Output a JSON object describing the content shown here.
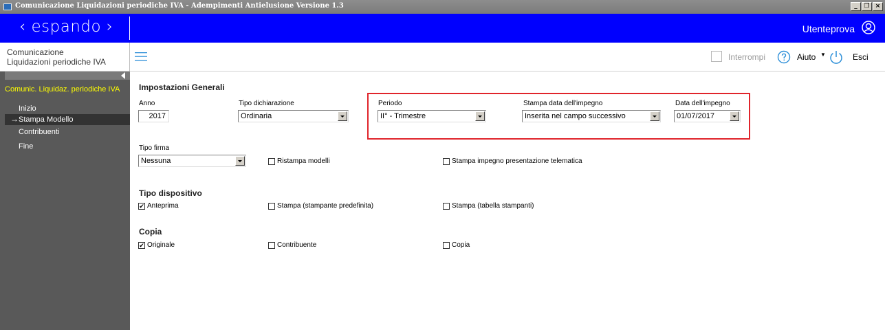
{
  "window": {
    "title": "Comunicazione Liquidazioni periodiche IVA - Adempimenti Antielusione Versione 1.3",
    "controls": [
      "_",
      "❐",
      "×"
    ]
  },
  "brand": {
    "logo": "‹ espando ›",
    "user_name": "Utenteprova",
    "color": "#0000fe"
  },
  "toolbar": {
    "module_title_line1": "Comunicazione",
    "module_title_line2": "Liquidazioni periodiche IVA",
    "interrompi_label": "Interrompi",
    "aiuto_label": "Aiuto",
    "esci_label": "Esci"
  },
  "sidebar": {
    "header": "Comunic. Liquidaz. periodiche IVA",
    "items": [
      {
        "label": "Inizio",
        "active": false
      },
      {
        "label": "Stampa Modello",
        "active": true
      },
      {
        "label": "Contribuenti",
        "active": false
      },
      {
        "label": "Fine",
        "active": false
      }
    ]
  },
  "form": {
    "section_general": "Impostazioni Generali",
    "anno": {
      "label": "Anno",
      "value": "2017"
    },
    "tipo_dichiarazione": {
      "label": "Tipo dichiarazione",
      "value": "Ordinaria"
    },
    "periodo": {
      "label": "Periodo",
      "value": "II° - Trimestre"
    },
    "stampa_data_impegno": {
      "label": "Stampa data dell'impegno",
      "value": "Inserita nel campo successivo"
    },
    "data_impegno": {
      "label": "Data dell'impegno",
      "value": "01/07/2017"
    },
    "tipo_firma": {
      "label": "Tipo firma",
      "value": "Nessuna"
    },
    "ristampa_modelli": {
      "label": "Ristampa modelli",
      "checked": false
    },
    "stampa_impegno_telematica": {
      "label": "Stampa impegno presentazione telematica",
      "checked": false
    },
    "section_dispositivo": "Tipo dispositivo",
    "anteprima": {
      "label": "Anteprima",
      "checked": true
    },
    "stampa_predefinita": {
      "label": "Stampa (stampante predefinita)",
      "checked": false
    },
    "stampa_tabella": {
      "label": "Stampa (tabella stampanti)",
      "checked": false
    },
    "section_copia": "Copia",
    "originale": {
      "label": "Originale",
      "checked": true
    },
    "contribuente": {
      "label": "Contribuente",
      "checked": false
    },
    "copia": {
      "label": "Copia",
      "checked": false
    }
  },
  "colors": {
    "highlight_border": "#e0242b",
    "sidebar_header": "#ffff00"
  }
}
